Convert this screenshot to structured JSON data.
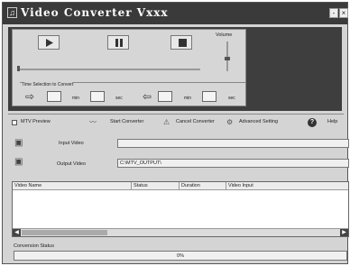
{
  "window": {
    "title": "Video Converter Vxxx",
    "minimize": "-",
    "close": "×"
  },
  "player": {
    "volume_label": "Volume"
  },
  "time_selection": {
    "title": "Time Selection to Convert",
    "start_min_label": "min",
    "start_sec_label": "sec",
    "end_min_label": "min",
    "end_sec_label": "sec"
  },
  "options": {
    "mtv_preview_label": "MTV Preview",
    "start_convert_label": "Start Converter",
    "cancel_convert_label": "Cancel Converter",
    "advanced_setting_label": "Advanced Setting",
    "help_label": "Help"
  },
  "files": {
    "input_label": "Input Video",
    "input_value": "",
    "output_label": "Output Video",
    "output_value": "C:\\MTV_OUTPUT\\"
  },
  "table": {
    "columns": [
      "Video Name",
      "Status",
      "Duration",
      "Video Input"
    ],
    "rows": []
  },
  "status": {
    "label": "Conversion Status",
    "progress_percent": 0,
    "progress_text": "0%"
  }
}
